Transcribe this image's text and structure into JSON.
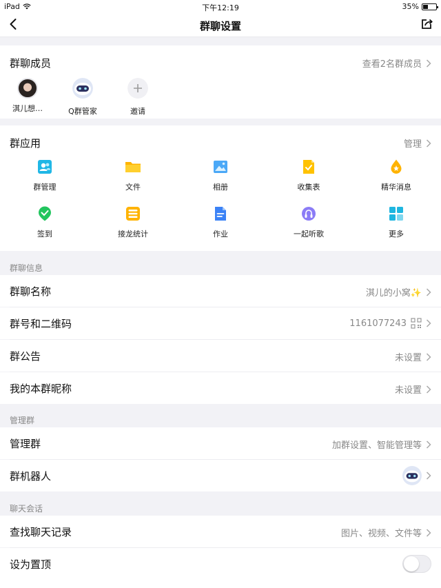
{
  "statusbar": {
    "device": "iPad",
    "time": "下午12:19",
    "battery": "35%",
    "battery_level": 0.35
  },
  "navbar": {
    "title": "群聊设置"
  },
  "members": {
    "title": "群聊成员",
    "view_all": "查看2名群成员",
    "items": [
      {
        "label": "淇儿想…"
      },
      {
        "label": "Q群管家"
      },
      {
        "label": "邀请"
      }
    ]
  },
  "apps": {
    "title": "群应用",
    "manage": "管理",
    "items": [
      {
        "label": "群管理",
        "icon": "group-manage-icon",
        "color": "#20b7e6"
      },
      {
        "label": "文件",
        "icon": "folder-icon",
        "color": "#ffc200"
      },
      {
        "label": "相册",
        "icon": "photo-album-icon",
        "color": "#3aa0f5"
      },
      {
        "label": "收集表",
        "icon": "form-icon",
        "color": "#ffc200"
      },
      {
        "label": "精华消息",
        "icon": "essence-icon",
        "color": "#ffb300"
      },
      {
        "label": "签到",
        "icon": "checkin-icon",
        "color": "#22c55e"
      },
      {
        "label": "接龙统计",
        "icon": "relay-icon",
        "color": "#ffb300"
      },
      {
        "label": "作业",
        "icon": "homework-icon",
        "color": "#3b82f6"
      },
      {
        "label": "一起听歌",
        "icon": "music-icon",
        "color": "#8b7cf6"
      },
      {
        "label": "更多",
        "icon": "more-grid-icon",
        "color": "#1fb6e0"
      }
    ]
  },
  "info": {
    "section": "群聊信息",
    "name_label": "群聊名称",
    "name_value": "淇儿的小窝✨",
    "number_label": "群号和二维码",
    "number_value": "1161077243",
    "notice_label": "群公告",
    "notice_value": "未设置",
    "nickname_label": "我的本群昵称",
    "nickname_value": "未设置"
  },
  "manage": {
    "section": "管理群",
    "manage_label": "管理群",
    "manage_value": "加群设置、智能管理等",
    "robot_label": "群机器人"
  },
  "chat": {
    "section": "聊天会话",
    "search_label": "查找聊天记录",
    "search_value": "图片、视频、文件等",
    "pin_label": "设为置顶"
  }
}
